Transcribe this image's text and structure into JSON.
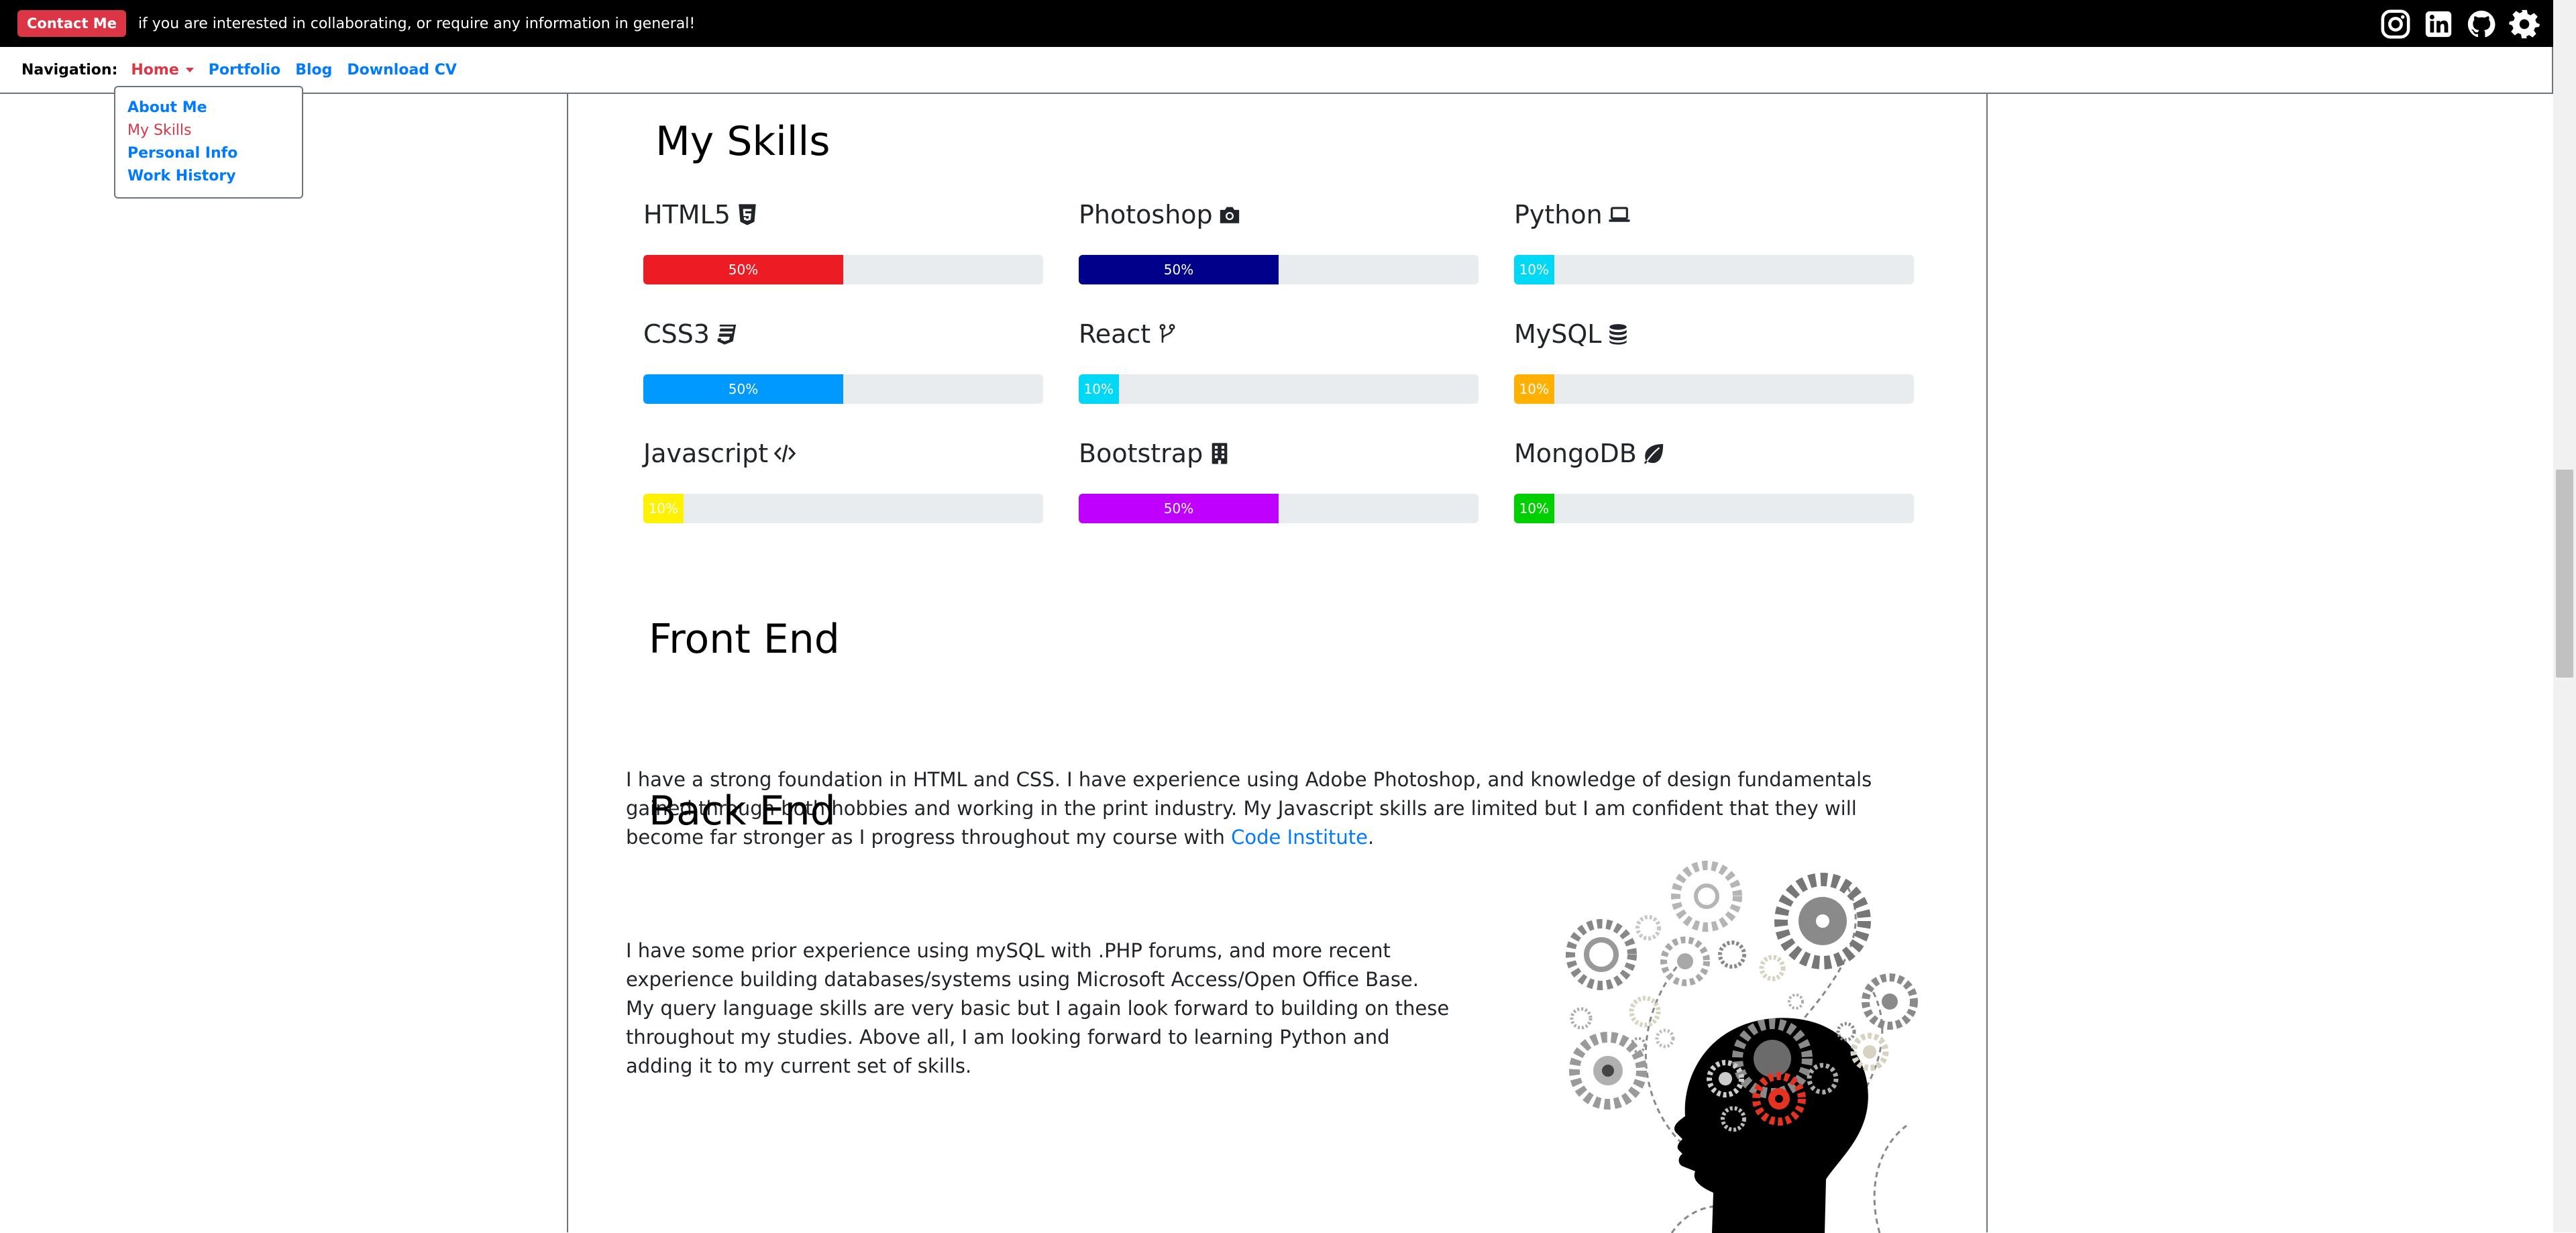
{
  "topbar": {
    "contact_label": "Contact Me",
    "text": "if you are interested in collaborating, or require any information in general!",
    "social_icons": [
      "instagram-icon",
      "linkedin-icon",
      "github-icon",
      "settings-gear-icon"
    ]
  },
  "nav": {
    "label": "Navigation:",
    "links": {
      "home": "Home",
      "portfolio": "Portfolio",
      "blog": "Blog",
      "download_cv": "Download CV"
    },
    "dropdown": [
      "About Me",
      "My Skills",
      "Personal Info",
      "Work History"
    ],
    "active_dropdown": "My Skills"
  },
  "skills": {
    "title": "My Skills",
    "items": [
      {
        "name": "HTML5",
        "icon": "html5-icon",
        "percent": 50,
        "label": "50%",
        "color": "#ed1c24"
      },
      {
        "name": "Photoshop",
        "icon": "camera-icon",
        "percent": 50,
        "label": "50%",
        "color": "#00008b"
      },
      {
        "name": "Python",
        "icon": "laptop-icon",
        "percent": 10,
        "label": "10%",
        "color": "#00d8f5"
      },
      {
        "name": "CSS3",
        "icon": "css3-icon",
        "percent": 50,
        "label": "50%",
        "color": "#0099ff"
      },
      {
        "name": "React",
        "icon": "code-branch-icon",
        "percent": 10,
        "label": "10%",
        "color": "#00d8f5"
      },
      {
        "name": "MySQL",
        "icon": "database-icon",
        "percent": 10,
        "label": "10%",
        "color": "#ffb000"
      },
      {
        "name": "Javascript",
        "icon": "code-icon",
        "percent": 10,
        "label": "10%",
        "color": "#fff200"
      },
      {
        "name": "Bootstrap",
        "icon": "building-icon",
        "percent": 50,
        "label": "50%",
        "color": "#bf00ff"
      },
      {
        "name": "MongoDB",
        "icon": "leaf-icon",
        "percent": 10,
        "label": "10%",
        "color": "#00d000"
      }
    ]
  },
  "front_end": {
    "title": "Front End",
    "text_before_link": "I have a strong foundation in HTML and CSS. I have experience using Adobe Photoshop, and knowledge of design fundamentals gained through both hobbies and working in the print industry. My Javascript skills are limited but I am confident that they will become far stronger as I progress throughout my course with ",
    "link": "Code Institute",
    "text_after_link": "."
  },
  "back_end": {
    "title": "Back End",
    "text": "I have some prior experience using mySQL with .PHP forums, and more recent experience building databases/systems using Microsoft Access/Open Office Base. My query language skills are very basic but I again look forward to building on these throughout my studies. Above all, I am looking forward to learning Python and adding it to my current set of skills."
  }
}
